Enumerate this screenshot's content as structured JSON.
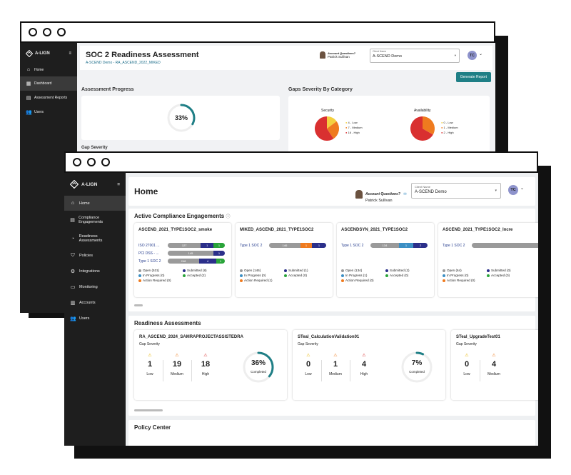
{
  "back_window": {
    "app_name": "A-LIGN",
    "nav": [
      {
        "label": "Home",
        "icon": "home-icon"
      },
      {
        "label": "Dashboard",
        "icon": "dashboard-icon"
      },
      {
        "label": "Assessment Reports",
        "icon": "report-icon"
      },
      {
        "label": "Users",
        "icon": "users-icon"
      }
    ],
    "title": "SOC 2 Readiness Assessment",
    "subtitle": "A-SCEND Demo - RA_ASCEND_2022_MIKED",
    "contact_question": "Account Questions?",
    "contact_name": "Patrick Sullivan",
    "client_label": "Client Name",
    "client_value": "A-SCEND Demo",
    "avatar": "TC",
    "generate_button": "Generate Report",
    "progress_title": "Assessment Progress",
    "progress_value": "33%",
    "progress_fraction": 0.33,
    "gaps_title": "Gaps Severity By Category",
    "gap_severity_label": "Gap Severity",
    "pies": [
      {
        "name": "Security",
        "legend": [
          "4 - Low",
          "7 - Medium",
          "16 - High"
        ],
        "values": [
          4,
          7,
          16
        ]
      },
      {
        "name": "Availability",
        "legend": [
          "0 - Low",
          "1 - Medium",
          "2 - High"
        ],
        "values": [
          0,
          1,
          2
        ]
      }
    ],
    "colors": {
      "low": "#f4d03f",
      "medium": "#ef7b1f",
      "high": "#d93030"
    }
  },
  "front_window": {
    "app_name": "A-LIGN",
    "nav": [
      {
        "label": "Home",
        "icon": "home-icon"
      },
      {
        "label": "Compliance Engagements",
        "icon": "document-icon"
      },
      {
        "label": "Readiness Assessments",
        "icon": "gauge-icon"
      },
      {
        "label": "Policies",
        "icon": "shield-check-icon"
      },
      {
        "label": "Integrations",
        "icon": "gear-icon"
      },
      {
        "label": "Monitoring",
        "icon": "monitor-icon"
      },
      {
        "label": "Accounts",
        "icon": "building-icon"
      },
      {
        "label": "Users",
        "icon": "users-icon"
      }
    ],
    "page_title": "Home",
    "contact_question": "Account Questions?",
    "contact_name": "Patrick Sullivan",
    "client_label": "Client Name",
    "client_value": "A-SCEND Demo",
    "avatar": "TC",
    "engagements_title": "Active Compliance Engagements",
    "engagements": [
      {
        "name": "ASCEND_2021_TYPE1SOC2_smoke",
        "rows": [
          {
            "label": "ISO 27001 ...",
            "segments": [
              [
                "grey",
                "127"
              ],
              [
                "navy",
                "1"
              ],
              [
                "green",
                "1"
              ]
            ]
          },
          {
            "label": "PCI DSS - ...",
            "segments": [
              [
                "grey",
                "145"
              ],
              [
                "navy",
                "1"
              ]
            ]
          },
          {
            "label": "Type 1 SOC 2",
            "segments": [
              [
                "grey",
                "248"
              ],
              [
                "navy",
                "4"
              ],
              [
                "green",
                "1"
              ]
            ]
          }
        ],
        "legend": [
          "Open (531)",
          "Submitted (8)",
          "In Progress (0)",
          "Accepted (2)",
          "Action Required (0)"
        ]
      },
      {
        "name": "MIKED_ASCEND_2021_TYPE1SOC2",
        "rows": [
          {
            "label": "Type 1 SOC 2",
            "segments": [
              [
                "grey",
                "146"
              ],
              [
                "orange",
                "1"
              ],
              [
                "navy",
                "1"
              ]
            ]
          }
        ],
        "legend": [
          "Open (146)",
          "Submitted (1)",
          "In Progress (0)",
          "Accepted (0)",
          "Action Required (1)"
        ]
      },
      {
        "name": "ASCENDSYN_2021_TYPE1SOC2",
        "rows": [
          {
            "label": "Type 1 SOC 2",
            "segments": [
              [
                "grey",
                "134"
              ],
              [
                "blue",
                "1"
              ],
              [
                "navy",
                "2"
              ]
            ]
          }
        ],
        "legend": [
          "Open (134)",
          "Submitted (2)",
          "In Progress (1)",
          "Accepted (0)",
          "Action Required (0)"
        ]
      },
      {
        "name": "ASCEND_2021_TYPE1SOC2_Incre",
        "rows": [
          {
            "label": "Type 1 SOC 2",
            "segments": [
              [
                "grey",
                ""
              ]
            ]
          }
        ],
        "legend": [
          "Open (64)",
          "Submitted (0)",
          "In Progress (0)",
          "Accepted (0)",
          "Action Required (0)"
        ]
      }
    ],
    "readiness_title": "Readiness Assessments",
    "assessments": [
      {
        "name": "RA_ASCEND_2024_SAMRAPROJECTASSISTEDRA",
        "gap_label": "Gap Severity",
        "low": "1",
        "medium": "19",
        "high": "18",
        "percent": "36%",
        "fraction": 0.36,
        "completed": "Completed"
      },
      {
        "name": "STeal_CalculationValidation01",
        "gap_label": "Gap Severity",
        "low": "0",
        "medium": "1",
        "high": "4",
        "percent": "7%",
        "fraction": 0.07,
        "completed": "Completed"
      },
      {
        "name": "STeal_UpgradeTest01",
        "gap_label": "Gap Severity",
        "low": "0",
        "medium": "4",
        "high": "",
        "percent": "",
        "fraction": 0,
        "completed": ""
      }
    ],
    "severity_labels": {
      "low": "Low",
      "medium": "Medium",
      "high": "High"
    },
    "policy_title": "Policy Center",
    "colors": {
      "accent": "#1f7f86",
      "open": "#9a9a9a",
      "submitted": "#2b2f8a",
      "in_progress": "#3c8fc4",
      "accepted": "#2aa43a",
      "action_required": "#ef7b1f"
    }
  }
}
